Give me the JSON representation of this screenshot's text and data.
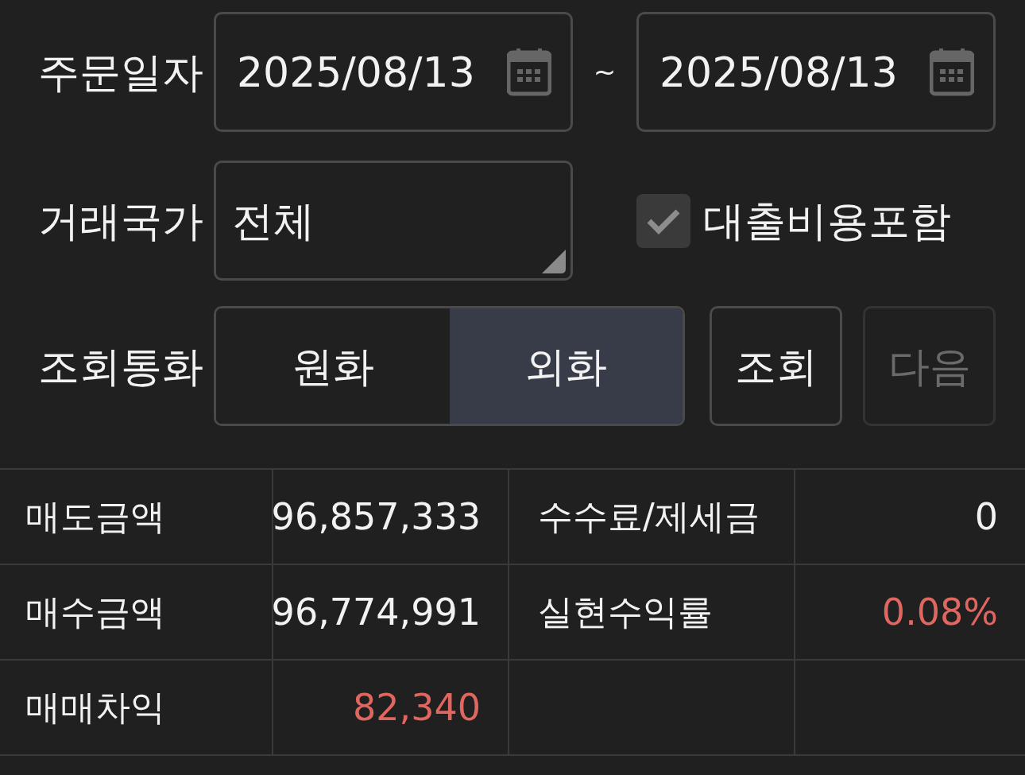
{
  "filters": {
    "order_date": {
      "label": "주문일자",
      "from": "2025/08/13",
      "separator": "~",
      "to": "2025/08/13"
    },
    "country": {
      "label": "거래국가",
      "value": "전체"
    },
    "include_loan_cost": {
      "label": "대출비용포함",
      "checked": true
    },
    "currency": {
      "label": "조회통화",
      "options": [
        {
          "label": "원화",
          "selected": false
        },
        {
          "label": "외화",
          "selected": true
        }
      ]
    },
    "buttons": [
      {
        "label": "조회",
        "disabled": false
      },
      {
        "label": "다음",
        "disabled": true
      }
    ]
  },
  "summary": {
    "rows": [
      {
        "cells": [
          {
            "kind": "label",
            "text": "매도금액"
          },
          {
            "kind": "value",
            "text": "96,857,333",
            "highlight": false
          },
          {
            "kind": "label",
            "text": "수수료/제세금"
          },
          {
            "kind": "value",
            "text": "0",
            "highlight": false
          }
        ]
      },
      {
        "cells": [
          {
            "kind": "label",
            "text": "매수금액"
          },
          {
            "kind": "value",
            "text": "96,774,991",
            "highlight": false
          },
          {
            "kind": "label",
            "text": "실현수익률"
          },
          {
            "kind": "value",
            "text": "0.08%",
            "highlight": true
          }
        ]
      },
      {
        "cells": [
          {
            "kind": "label",
            "text": "매매차익"
          },
          {
            "kind": "value",
            "text": "82,340",
            "highlight": true
          }
        ]
      }
    ]
  }
}
